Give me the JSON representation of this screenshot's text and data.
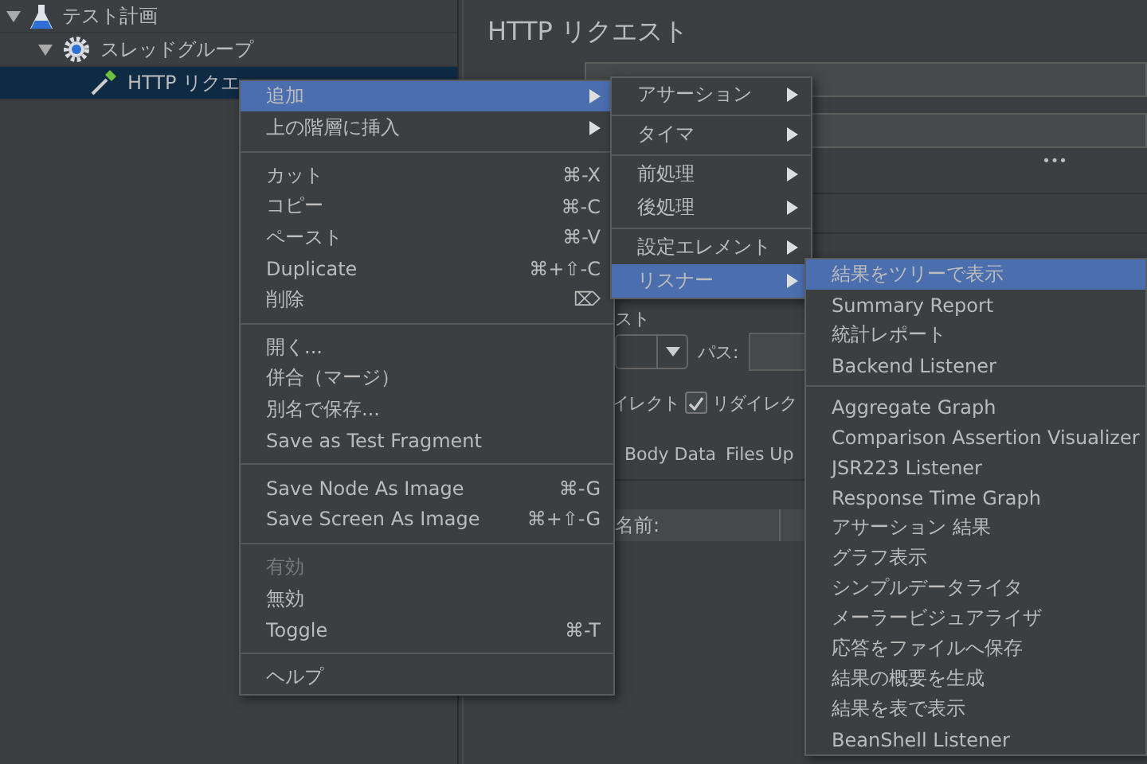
{
  "tree": {
    "items": [
      {
        "label": "テスト計画",
        "kind": "plan",
        "expanded": true,
        "selected": false,
        "children": [
          {
            "label": "スレッドグループ",
            "kind": "thread",
            "expanded": true,
            "selected": false,
            "children": [
              {
                "label": "HTTP リクエ",
                "kind": "sampler",
                "selected": true
              }
            ]
          }
        ]
      }
    ]
  },
  "panel": {
    "title": "HTTP リクエスト",
    "more_button": "•••",
    "section_label": "スト",
    "path_label": "パス:",
    "redirect_label": "イレクト",
    "follow_redirects": {
      "label": "リダイレク",
      "checked": true
    },
    "tabs": [
      "Body Data",
      "Files Up"
    ],
    "table_header": "名前:"
  },
  "context_menu": {
    "groups": [
      [
        {
          "label": "追加",
          "submenu": true,
          "selected": true,
          "disabled": false
        },
        {
          "label": "上の階層に挿入",
          "submenu": true,
          "selected": false,
          "disabled": false
        }
      ],
      [
        {
          "label": "カット",
          "shortcut": "⌘-X",
          "selected": false,
          "disabled": false
        },
        {
          "label": "コピー",
          "shortcut": "⌘-C",
          "selected": false,
          "disabled": false
        },
        {
          "label": "ペースト",
          "shortcut": "⌘-V",
          "selected": false,
          "disabled": false
        },
        {
          "label": "Duplicate",
          "shortcut": "⌘+⇧-C",
          "selected": false,
          "disabled": false
        },
        {
          "label": "削除",
          "shortcut": "⌦",
          "selected": false,
          "disabled": false
        }
      ],
      [
        {
          "label": "開く...",
          "selected": false,
          "disabled": false
        },
        {
          "label": "併合（マージ）",
          "selected": false,
          "disabled": false
        },
        {
          "label": "別名で保存...",
          "selected": false,
          "disabled": false
        },
        {
          "label": "Save as Test Fragment",
          "selected": false,
          "disabled": false
        }
      ],
      [
        {
          "label": "Save Node As Image",
          "shortcut": "⌘-G",
          "selected": false,
          "disabled": false
        },
        {
          "label": "Save Screen As Image",
          "shortcut": "⌘+⇧-G",
          "selected": false,
          "disabled": false
        }
      ],
      [
        {
          "label": "有効",
          "selected": false,
          "disabled": true
        },
        {
          "label": "無効",
          "selected": false,
          "disabled": false
        },
        {
          "label": "Toggle",
          "shortcut": "⌘-T",
          "selected": false,
          "disabled": false
        }
      ],
      [
        {
          "label": "ヘルプ",
          "selected": false,
          "disabled": false
        }
      ]
    ]
  },
  "add_submenu": {
    "groups": [
      [
        {
          "label": "アサーション",
          "submenu": true,
          "selected": false
        }
      ],
      [
        {
          "label": "タイマ",
          "submenu": true,
          "selected": false
        }
      ],
      [
        {
          "label": "前処理",
          "submenu": true,
          "selected": false
        },
        {
          "label": "後処理",
          "submenu": true,
          "selected": false
        }
      ],
      [
        {
          "label": "設定エレメント",
          "submenu": true,
          "selected": false
        },
        {
          "label": "リスナー",
          "submenu": true,
          "selected": true
        }
      ]
    ]
  },
  "listener_submenu": {
    "groups": [
      [
        {
          "label": "結果をツリーで表示",
          "selected": true
        },
        {
          "label": "Summary Report",
          "selected": false
        },
        {
          "label": "統計レポート",
          "selected": false
        },
        {
          "label": "Backend Listener",
          "selected": false
        }
      ],
      [
        {
          "label": "Aggregate Graph",
          "selected": false
        },
        {
          "label": "Comparison Assertion Visualizer",
          "selected": false
        },
        {
          "label": "JSR223 Listener",
          "selected": false
        },
        {
          "label": "Response Time Graph",
          "selected": false
        },
        {
          "label": "アサーション 結果",
          "selected": false
        },
        {
          "label": "グラフ表示",
          "selected": false
        },
        {
          "label": "シンプルデータライタ",
          "selected": false
        },
        {
          "label": "メーラービジュアライザ",
          "selected": false
        },
        {
          "label": "応答をファイルへ保存",
          "selected": false
        },
        {
          "label": "結果の概要を生成",
          "selected": false
        },
        {
          "label": "結果を表で表示",
          "selected": false
        },
        {
          "label": "BeanShell Listener",
          "selected": false
        }
      ]
    ]
  }
}
